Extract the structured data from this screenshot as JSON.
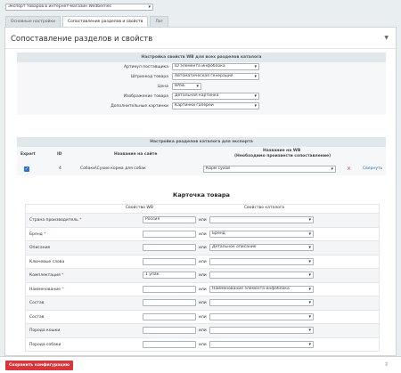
{
  "top_select": {
    "value": "Экспорт товаров в интернет-магазин Wildberries"
  },
  "tabs": [
    {
      "label": "Основные настройки"
    },
    {
      "label": "Сопоставление разделов и свойств"
    },
    {
      "label": "Лог"
    }
  ],
  "panel": {
    "title": "Сопоставление разделов и свойств"
  },
  "settings": {
    "heading": "Настройка свойств WB для всех разделов каталога",
    "rows": [
      {
        "label": "Артикул поставщика",
        "value": "ID элемента инфоблока"
      },
      {
        "label": "Штрихкод товара",
        "value": "Автоматическая генерация"
      },
      {
        "label": "Цена",
        "value": "BASE"
      },
      {
        "label": "Изображение товара",
        "value": "Детальная картинка"
      },
      {
        "label": "Дополнительные картинки",
        "value": "Картинки галереи"
      }
    ]
  },
  "sections": {
    "heading": "Настройка разделов каталога для экспорта",
    "columns": {
      "export": "Export",
      "id": "ID",
      "site_name": "Название на сайте",
      "wb_name_line1": "Название на WB",
      "wb_name_line2": "(Необходимо произвести сопоставление)"
    },
    "rows": [
      {
        "id": "4",
        "name": "Собаки\\Сухие корма для собак",
        "wb_value": "Корм сухой",
        "remove": "×",
        "collapse": "Свернуть"
      }
    ]
  },
  "card": {
    "title": "Карточка товара",
    "col_wb": "Свойство WB",
    "col_catalog": "Свойство каталога",
    "or_label": "или",
    "rows": [
      {
        "name": "Страна производитель",
        "required": true,
        "input": "Россия",
        "select": ""
      },
      {
        "name": "Бренд",
        "required": true,
        "input": "",
        "select": "Бренд"
      },
      {
        "name": "Описание",
        "required": false,
        "input": "",
        "select": "Детальное описание"
      },
      {
        "name": "Ключевые слова",
        "required": false,
        "input": "",
        "select": ""
      },
      {
        "name": "Комплектация",
        "required": true,
        "input": "1 упак.",
        "select": ""
      },
      {
        "name": "Наименование",
        "required": true,
        "input": "",
        "select": "Наименование элемента инфоблока"
      },
      {
        "name": "Состав",
        "required": false,
        "input": "",
        "select": ""
      },
      {
        "name": "Состав",
        "required": false,
        "input": "",
        "select": ""
      },
      {
        "name": "Порода кошки",
        "required": false,
        "input": "",
        "select": ""
      },
      {
        "name": "Порода собаки",
        "required": false,
        "input": "",
        "select": ""
      }
    ]
  },
  "footer": {
    "save_label": "Сохранить конфигурацию",
    "grip": "⇕"
  },
  "colors": {
    "accent_red": "#d9353a",
    "section_head": "#e0e8eb",
    "link_blue": "#2f6fb0"
  }
}
